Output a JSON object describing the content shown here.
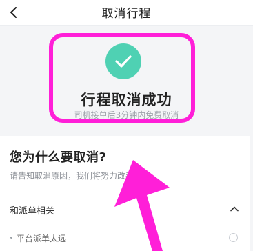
{
  "header": {
    "title": "取消行程",
    "back_icon": "chevron-left-icon"
  },
  "success": {
    "icon": "check-icon",
    "title": "行程取消成功",
    "subtitle": "司机接单后3分钟内免费取消",
    "accent_color": "#4fd1b3"
  },
  "reasons": {
    "heading": "您为什么要取消?",
    "hint": "请告知取消原因，我们将努力改善",
    "group": {
      "title": "和派单相关",
      "icon": "chevron-up-icon",
      "options": [
        {
          "label": "平台派单太远"
        }
      ]
    }
  },
  "annotation": {
    "highlight_color": "#ff1fd8"
  }
}
